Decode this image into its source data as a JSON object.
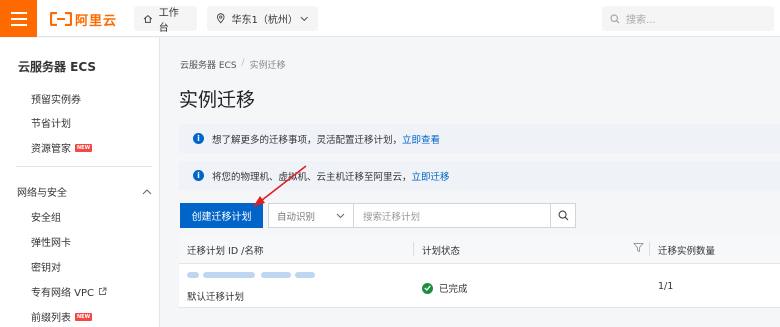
{
  "topbar": {
    "logo_text": "阿里云",
    "workbench_label": "工作台",
    "region_label": "华东1（杭州）",
    "search_placeholder": "搜索..."
  },
  "sidebar": {
    "title": "云服务器 ECS",
    "items_top": [
      {
        "label": "预留实例券",
        "badge": ""
      },
      {
        "label": "节省计划",
        "badge": ""
      },
      {
        "label": "资源管家",
        "badge": "NEW"
      }
    ],
    "group_label": "网络与安全",
    "items_network": [
      {
        "label": "安全组",
        "badge": ""
      },
      {
        "label": "弹性网卡",
        "badge": ""
      },
      {
        "label": "密钥对",
        "badge": ""
      },
      {
        "label": "专有网络 VPC",
        "badge": ""
      },
      {
        "label": "前缀列表",
        "badge": "NEW"
      }
    ]
  },
  "breadcrumb": {
    "parent": "云服务器 ECS",
    "separator": "/",
    "current": "实例迁移"
  },
  "page_title": "实例迁移",
  "notices": [
    {
      "text": "想了解更多的迁移事项，灵活配置迁移计划，",
      "link": "立即查看"
    },
    {
      "text": "将您的物理机、虚拟机、云主机迁移至阿里云，",
      "link": "立即迁移"
    }
  ],
  "toolbar": {
    "create_label": "创建迁移计划",
    "filter_value": "自动识别",
    "search_placeholder": "搜索迁移计划"
  },
  "table": {
    "columns": [
      "迁移计划 ID /名称",
      "计划状态",
      "迁移实例数量"
    ],
    "rows": [
      {
        "id_redacted": true,
        "name": "默认迁移计划",
        "status": "已完成",
        "instances": "1/1"
      }
    ]
  },
  "colors": {
    "brand_orange": "#ff6a00",
    "primary_blue": "#0064c8",
    "annotation_red": "#e02020",
    "success_green": "#1e8e3e"
  },
  "icons": [
    "menu-icon",
    "aliyun-logo-icon",
    "home-icon",
    "location-pin-icon",
    "chevron-down-icon",
    "search-icon",
    "new-badge",
    "external-link-icon",
    "chevron-up-icon",
    "info-icon",
    "filter-icon",
    "check-circle-icon",
    "annotation-arrow"
  ]
}
